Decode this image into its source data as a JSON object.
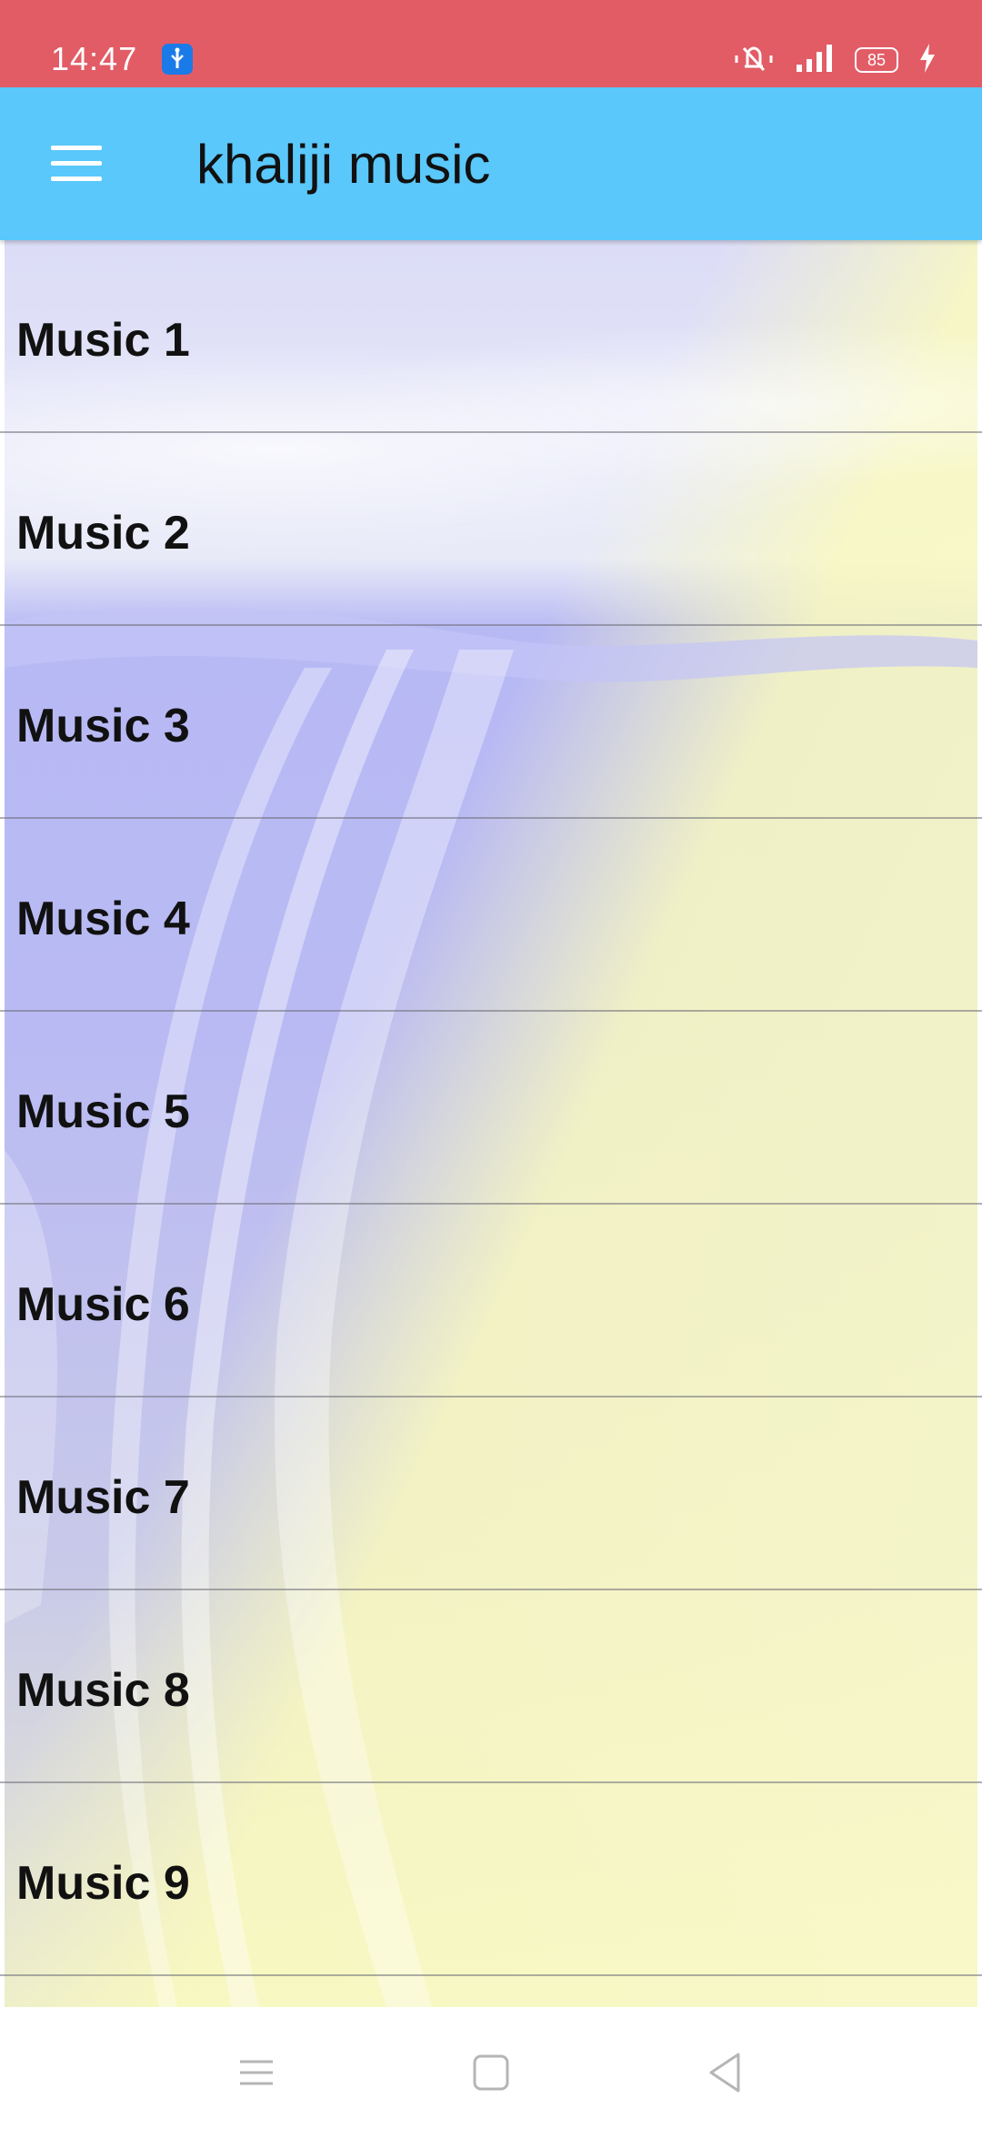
{
  "status_bar": {
    "time": "14:47",
    "battery_level": "85",
    "icons": [
      "usb-debug-icon",
      "mute-icon",
      "signal-icon",
      "battery-icon",
      "charging-icon"
    ]
  },
  "app_bar": {
    "title": "khaliji music",
    "menu_icon": "hamburger-menu-icon",
    "color": "#5ac8fb"
  },
  "list": {
    "items": [
      {
        "label": "Music 1"
      },
      {
        "label": "Music 2"
      },
      {
        "label": "Music 3"
      },
      {
        "label": "Music 4"
      },
      {
        "label": "Music 5"
      },
      {
        "label": "Music 6"
      },
      {
        "label": "Music 7"
      },
      {
        "label": "Music 8"
      },
      {
        "label": "Music 9"
      }
    ]
  },
  "nav_bar": {
    "buttons": [
      "recents-icon",
      "home-icon",
      "back-icon"
    ]
  },
  "colors": {
    "status_bar": "#e25c66",
    "app_bar": "#5ac8fb",
    "divider": "#6e6e78"
  }
}
